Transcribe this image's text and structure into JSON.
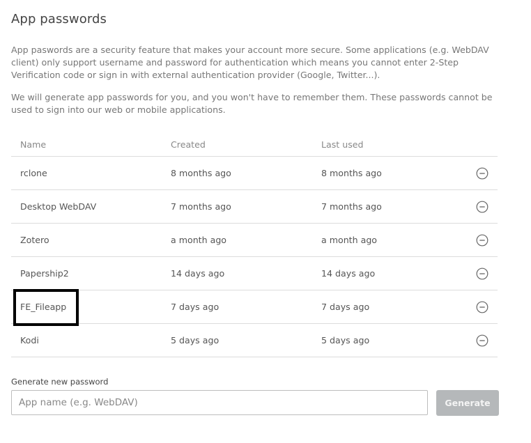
{
  "page": {
    "title": "App passwords",
    "description_1": "App paswords are a security feature that makes your account more secure. Some applications (e.g. WebDAV client) only support username and password for authentication which means you cannot enter 2-Step Verification code or sign in with external authentication provider (Google, Twitter...).",
    "description_2": "We will generate app passwords for you, and you won't have to remember them. These passwords cannot be used to sign into our web or mobile applications."
  },
  "table": {
    "columns": [
      "Name",
      "Created",
      "Last used"
    ],
    "rows": [
      {
        "name": "rclone",
        "created": "8 months ago",
        "last_used": "8 months ago",
        "action_icon": "remove-circle-icon"
      },
      {
        "name": "Desktop WebDAV",
        "created": "7 months ago",
        "last_used": "7 months ago",
        "action_icon": "remove-circle-icon"
      },
      {
        "name": "Zotero",
        "created": "a month ago",
        "last_used": "a month ago",
        "action_icon": "remove-circle-icon"
      },
      {
        "name": "Papership2",
        "created": "14 days ago",
        "last_used": "14 days ago",
        "action_icon": "remove-circle-icon"
      },
      {
        "name": "FE_Fileapp",
        "created": "7 days ago",
        "last_used": "7 days ago",
        "action_icon": "remove-circle-icon"
      },
      {
        "name": "Kodi",
        "created": "5 days ago",
        "last_used": "5 days ago",
        "action_icon": "remove-circle-icon"
      }
    ]
  },
  "generate": {
    "label": "Generate new password",
    "input_value": "",
    "input_placeholder": "App name (e.g. WebDAV)",
    "button_label": "Generate"
  },
  "colors": {
    "button_disabled": "#b5b8ba",
    "highlight_border": "#000000"
  }
}
